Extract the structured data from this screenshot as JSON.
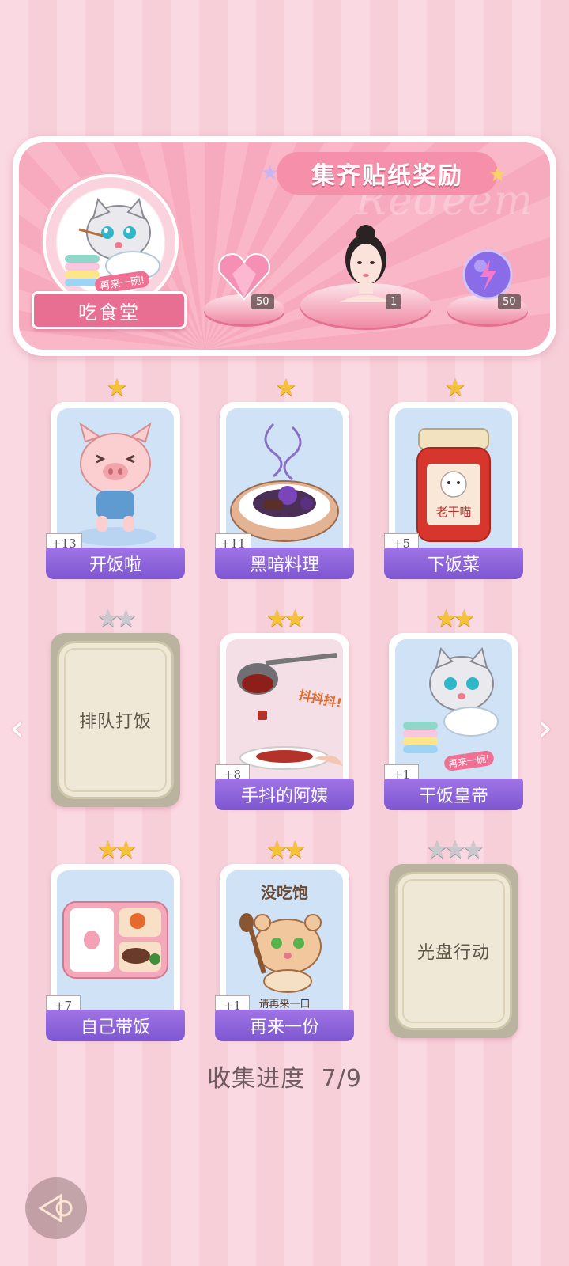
{
  "banner": {
    "title": "集齐贴纸奖励",
    "watermark": "Redeem",
    "album_name": "吃食堂",
    "album_cat_caption": "再来一碗!",
    "rewards": [
      {
        "icon": "pink-heart-gem-icon",
        "count": "50"
      },
      {
        "icon": "avatar-portrait-icon",
        "count": "1"
      },
      {
        "icon": "purple-energy-orb-icon",
        "count": "50"
      }
    ]
  },
  "cards": [
    {
      "label": "开饭啦",
      "bonus": "+13",
      "stars": 1,
      "collected": true,
      "art": "happy-pig-icon"
    },
    {
      "label": "黑暗料理",
      "bonus": "+11",
      "stars": 1,
      "collected": true,
      "art": "dark-dish-icon"
    },
    {
      "label": "下饭菜",
      "bonus": "+5",
      "stars": 1,
      "collected": true,
      "art": "chili-jar-icon",
      "art_text": "老干喵"
    },
    {
      "label": "排队打饭",
      "bonus": "",
      "stars": 2,
      "collected": false,
      "art": ""
    },
    {
      "label": "手抖的阿姨",
      "bonus": "+8",
      "stars": 2,
      "collected": true,
      "art": "ladle-pour-icon",
      "art_text": "抖抖抖!"
    },
    {
      "label": "干饭皇帝",
      "bonus": "+1",
      "stars": 2,
      "collected": true,
      "art": "rice-cat-icon",
      "art_text": "再来一碗!"
    },
    {
      "label": "自己带饭",
      "bonus": "+7",
      "stars": 2,
      "collected": true,
      "art": "bento-box-icon"
    },
    {
      "label": "再来一份",
      "bonus": "+1",
      "stars": 2,
      "collected": true,
      "art": "hungry-hamster-icon",
      "art_text": "没吃饱",
      "art_sub": "请再来一口"
    },
    {
      "label": "光盘行动",
      "bonus": "",
      "stars": 3,
      "collected": false,
      "art": ""
    }
  ],
  "progress": {
    "label": "收集进度",
    "value": "7/9"
  },
  "colors": {
    "card_label_bg": "#8a62d9",
    "star_gold": "#f6c23a",
    "star_grey": "#c9c9cf",
    "banner_pink": "#f7a9bd"
  }
}
